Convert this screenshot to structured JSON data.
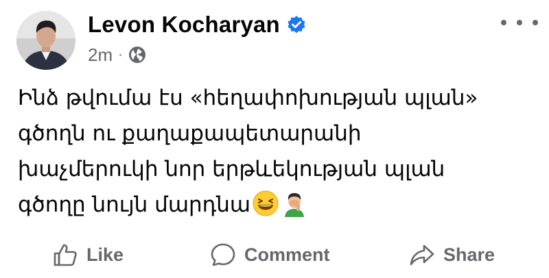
{
  "post": {
    "author_name": "Levon Kocharyan",
    "timestamp": "2m",
    "separator": "·",
    "privacy_icon": "globe-icon",
    "verified_icon": "verified-badge-icon",
    "text_lines": [
      "Ինձ թվումա էս «հեղափոխության պլան»",
      "գծողն ու քաղաքապետարանի",
      "խաչմերուկի նոր երթևեկության պլան",
      "գծողը նույն մարդնա"
    ],
    "emojis": [
      "grinning-squinting-face-emoji",
      "man-facepalming-emoji"
    ]
  },
  "actions": {
    "like_label": "Like",
    "comment_label": "Comment",
    "share_label": "Share"
  },
  "colors": {
    "text_primary": "#050505",
    "text_secondary": "#65676b",
    "verified_blue": "#1877f2"
  }
}
